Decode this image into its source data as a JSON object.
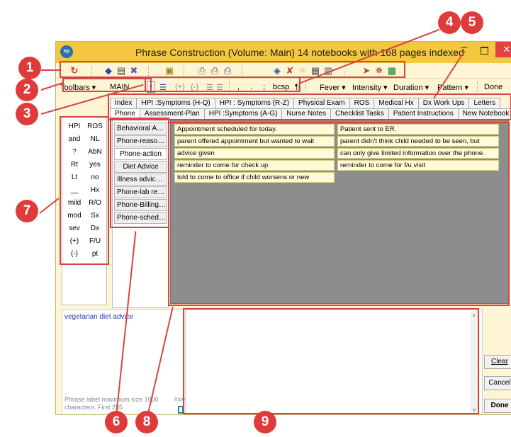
{
  "window": {
    "app_icon": "ep",
    "title": "Phrase Construction (Volume: Main)  14 notebooks with 168 pages indexed",
    "minimize": "–",
    "close": "✕"
  },
  "toolbar1": {
    "icons": [
      "refresh-icon",
      "tag-icon",
      "book-icon",
      "notebook-icon",
      "clipboard-icon",
      "print-icon",
      "print-preview-icon",
      "print-setup-icon",
      "eraser-icon",
      "delete-icon",
      "sparkle-icon",
      "form-icon",
      "printer-icon",
      "export-icon",
      "import-icon",
      "sync-icon"
    ]
  },
  "toolbar2": {
    "toolbars_label": "Toolbars ▾",
    "toolbar_name": "MAIN",
    "format_items": [
      "☰",
      "(+)",
      "(-)",
      "☰",
      "☰",
      ",",
      ".",
      ";",
      "bcsp",
      "¶"
    ],
    "menus": [
      "Fever ▾",
      "Intensity ▾",
      "Duration ▾",
      "Pattern ▾"
    ],
    "done": "Done"
  },
  "tabs": {
    "row1": [
      "Index",
      "HPI :Symptoms (H-Q)",
      "HPI : Symptoms (R-Z)",
      "Physical Exam",
      "ROS",
      "Medical Hx",
      "Dx Work Ups",
      "Letters"
    ],
    "row2": [
      "Phone",
      "Assessment-Plan",
      "HPI :Symptoms (A-G)",
      "Nurse Notes",
      "Checklist Tasks",
      "Patient Instructions",
      "New Notebook"
    ],
    "active": "Phone"
  },
  "keywords": {
    "col1": [
      "HPI",
      "and",
      "?",
      "Rt",
      "Lt",
      "__",
      "mild",
      "mod",
      "sev",
      "(+)",
      "(-)"
    ],
    "col2": [
      "ROS",
      "NL",
      "AbN",
      "yes",
      "no",
      "Hx",
      "R/O",
      "Sx",
      "Dx",
      "F/U",
      "pt"
    ]
  },
  "categories": [
    "Behavioral Advi...",
    "Phone-reason f...",
    "Phone-action",
    "Diet Advice",
    "Illness advice (...",
    "Phone-lab results",
    "Phone-Billing q...",
    "Phone-scheduli..."
  ],
  "active_category": "Phone-action",
  "phrases": {
    "col1": [
      "Appointment scheduled for today.",
      "parent offered appointment but wanted to wait",
      "advice given",
      "reminder to come for check up",
      "told to come to office if child worsens or new"
    ],
    "col2": [
      "Patient sent to ER.",
      "parent didn't think child needed to be seen, but",
      "can only give limited information over the phone.",
      "reminder to come for f/u visit"
    ]
  },
  "description": {
    "text": "vegetarian diet advice",
    "note": "Phrase label maximum size 1000 characters. First 255",
    "insert_label": "Insert"
  },
  "buttons": {
    "clear": "Clear",
    "cancel": "Cancel",
    "done": "Done"
  },
  "callouts": [
    "1",
    "2",
    "3",
    "4",
    "5",
    "6",
    "7",
    "8",
    "9"
  ],
  "colors": {
    "titlebar": "#f3c73e",
    "window_bg": "#fdf5d4",
    "phrase_bg": "#fffbd6",
    "grid_bg": "#8d8d8d",
    "callout": "#e03b3b",
    "close": "#e04343"
  }
}
